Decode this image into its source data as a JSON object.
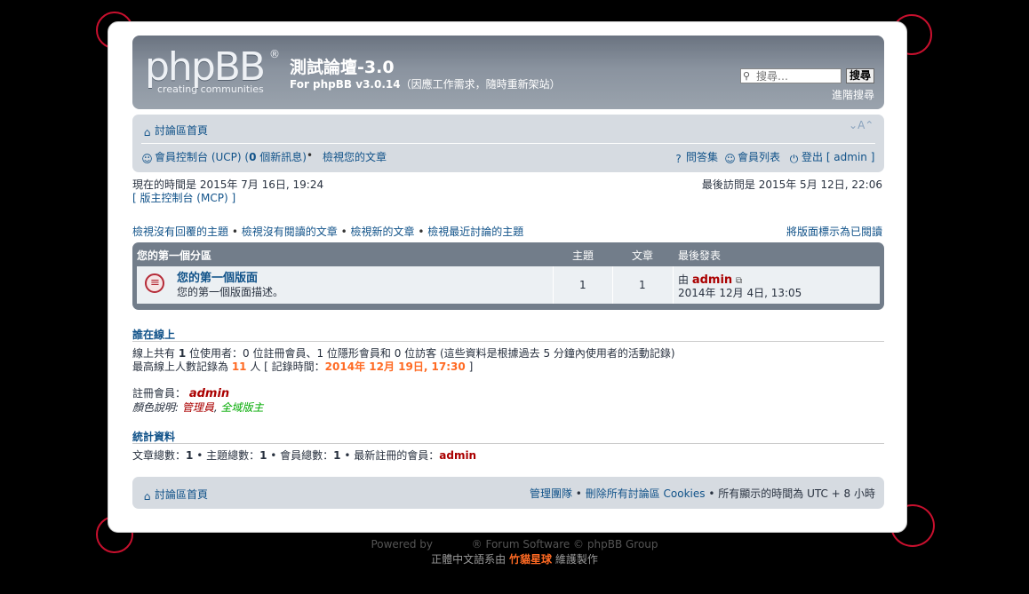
{
  "header": {
    "logo_text": "phpBB",
    "logo_reg": "®",
    "logo_tagline": "creating    communities",
    "site_title": "測試論壇-3.0",
    "site_desc_bold": "For phpBB v3.0.14",
    "site_desc_rest": "（因應工作需求，隨時重新架站）",
    "search_placeholder": "搜尋…",
    "search_button": "搜尋",
    "advanced_search": "進階搜尋"
  },
  "navbar": {
    "home": "討論區首頁",
    "font_size": "A",
    "ucp": "會員控制台 (UCP) (",
    "ucp_new_count": "0",
    "ucp_new_label": " 個新訊息)",
    "bullet": "•",
    "view_own_posts": "檢視您的文章",
    "faq": "問答集",
    "member_list": "會員列表",
    "logout": "登出 [ admin ]"
  },
  "info": {
    "current_time": "現在的時間是 2015年 7月 16日, 19:24",
    "mcp": "[ 版主控制台 (MCP) ]",
    "last_visit": "最後訪問是 2015年 5月 12日, 22:06"
  },
  "quicklinks": {
    "unanswered": "檢視沒有回覆的主題",
    "unread": "檢視沒有閱讀的文章",
    "new_posts": "檢視新的文章",
    "active_topics": "檢視最近討論的主題",
    "mark_read": "將版面標示為已閱讀"
  },
  "forum": {
    "category": "您的第一個分區",
    "col_topics": "主題",
    "col_posts": "文章",
    "col_last_post": "最後發表",
    "rows": [
      {
        "name": "您的第一個版面",
        "desc": "您的第一個版面描述。",
        "topics": "1",
        "posts": "1",
        "last_by_prefix": "由",
        "last_by_user": "admin",
        "last_time": "2014年 12月 4日, 13:05"
      }
    ]
  },
  "online": {
    "heading": "誰在線上",
    "line1_pre": "線上共有 ",
    "line1_count": "1",
    "line1_post": " 位使用者：0 位註冊會員、1 位隱形會員和 0 位訪客 (這些資料是根據過去 5 分鐘內使用者的活動記錄)",
    "line2_pre": "最高線上人數記錄為 ",
    "line2_count": "11",
    "line2_mid": " 人 [ 記錄時間：",
    "line2_time": "2014年 12月 19日, 17:30",
    "line2_end": " ]",
    "registered_label": "註冊會員：",
    "registered_user": "admin",
    "legend_label": "顏色說明:",
    "legend_admin": "管理員",
    "legend_sep": ",",
    "legend_globalmod": "全域版主"
  },
  "stats": {
    "heading": "統計資料",
    "total_posts_label": "文章總數：",
    "total_posts": "1",
    "total_topics_label": " • 主題總數：",
    "total_topics": "1",
    "total_members_label": " • 會員總數：",
    "total_members": "1",
    "newest_label": " • 最新註冊的會員：",
    "newest_member": "admin"
  },
  "footer": {
    "home": "討論區首頁",
    "team": "管理團隊",
    "delete_cookies": "刪除所有討論區",
    "cookies": "Cookies",
    "timezone": "• 所有顯示的時間為 UTC + 8 小時",
    "powered_a": "Powered by",
    "powered_b": "® Forum Software © phpBB Group",
    "translation_a": "正體中文語系由",
    "translation_b": "竹貓星球",
    "translation_c": "維護製作"
  },
  "colors": {
    "link": "#105289",
    "admin_red": "#aa0000",
    "highlight_orange": "#ff6a23",
    "globalmod_green": "#00aa00",
    "header_bg": "#7b8590",
    "forum_bg": "#727d8a"
  }
}
